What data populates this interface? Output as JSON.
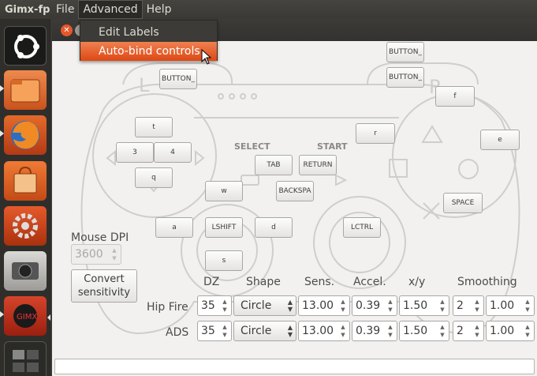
{
  "app": {
    "title": "Gimx-fp"
  },
  "menubar": {
    "file": "File",
    "advanced": "Advanced",
    "help": "Help"
  },
  "advanced_menu": {
    "edit_labels": "Edit Labels",
    "auto_bind": "Auto-bind controls"
  },
  "launcher": [
    "ubuntu-home-icon",
    "files-icon",
    "firefox-icon",
    "software-center-icon",
    "system-settings-icon",
    "camera-icon",
    "gimx-app-icon",
    "workspace-switcher-icon"
  ],
  "controller": {
    "select": "SELECT",
    "start": "START",
    "l_letter": "L",
    "r_letter": "R",
    "l1": "BUTTON_",
    "r1": "BUTTON_",
    "r2": "BUTTON_",
    "up": "t",
    "left": "3",
    "right": "4",
    "down": "q",
    "select_btn": "TAB",
    "start_btn": "RETURN",
    "ps_btn": "BACKSPA",
    "triangle": "f",
    "square": "r",
    "circle": "e",
    "cross": "SPACE",
    "lstick_up": "w",
    "lstick_left": "a",
    "lstick_center": "LSHIFT",
    "lstick_right": "d",
    "lstick_down": "s",
    "rstick_center": "LCTRL"
  },
  "mouse": {
    "dpi_label": "Mouse DPI",
    "dpi_value": "3600",
    "convert_line1": "Convert",
    "convert_line2": "sensitivity"
  },
  "headers": {
    "dz": "DZ",
    "shape": "Shape",
    "sens": "Sens.",
    "accel": "Accel.",
    "xy": "x/y",
    "smoothing": "Smoothing"
  },
  "rows": [
    {
      "label": "Hip Fire",
      "dz": "35",
      "shape": "Circle",
      "sens": "13.00",
      "accel": "0.39",
      "xy": "1.50",
      "smooth_a": "2",
      "smooth_b": "1.00"
    },
    {
      "label": "ADS",
      "dz": "35",
      "shape": "Circle",
      "sens": "13.00",
      "accel": "0.39",
      "xy": "1.50",
      "smooth_a": "2",
      "smooth_b": "1.00"
    }
  ],
  "status": {
    "text": ""
  },
  "colors": {
    "accent": "#dd4814",
    "panel": "#3c3b37",
    "window": "#f2f1f0"
  }
}
